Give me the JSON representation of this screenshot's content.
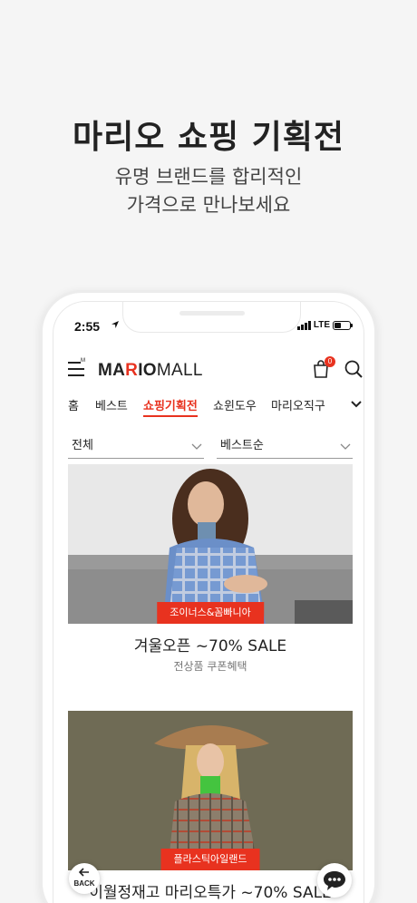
{
  "promo": {
    "title": "마리오 쇼핑 기획전",
    "subtitle_line1": "유명 브랜드를 합리적인",
    "subtitle_line2": "가격으로 만나보세요"
  },
  "status_bar": {
    "time": "2:55",
    "network": "LTE"
  },
  "header": {
    "menu_superscript": "M",
    "logo_part1": "MA",
    "logo_accent": "R",
    "logo_part2": "IO",
    "logo_part3": "MALL",
    "cart_count": "0",
    "accent_color": "#e8321f"
  },
  "tabs": [
    {
      "label": "홈",
      "active": false
    },
    {
      "label": "베스트",
      "active": false
    },
    {
      "label": "쇼핑기획전",
      "active": true
    },
    {
      "label": "쇼윈도우",
      "active": false
    },
    {
      "label": "마리오직구",
      "active": false
    }
  ],
  "filters": {
    "category": "전체",
    "sort": "베스트순"
  },
  "cards": [
    {
      "tag": "조이너스&꼼빠니아",
      "title": "겨울오픈 ~70% SALE",
      "subtitle": "전상품 쿠폰혜택"
    },
    {
      "tag": "플라스틱아일랜드",
      "title": "이월정재고 마리오특가 ~70% SALE",
      "subtitle": ""
    }
  ],
  "floating": {
    "back_label": "BACK",
    "chat_icon": "chat-bubble-icon"
  }
}
